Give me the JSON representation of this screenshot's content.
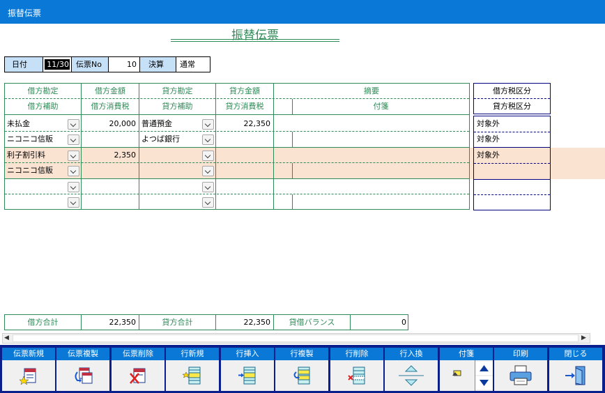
{
  "window": {
    "title": "振替伝票"
  },
  "doc_title": "振替伝票",
  "header": {
    "date_label": "日付",
    "date_value": "11/30",
    "voucher_no_label": "伝票No",
    "voucher_no_value": "10",
    "settlement_label": "決算",
    "settlement_value": "通常"
  },
  "columns": {
    "debit_account": "借方勘定",
    "debit_amount": "借方金額",
    "credit_account": "貸方勘定",
    "credit_amount": "貸方金額",
    "summary": "摘要",
    "debit_sub": "借方補助",
    "debit_tax": "借方消費税",
    "credit_sub": "貸方補助",
    "credit_tax": "貸方消費税",
    "note": "付箋",
    "debit_tax_class": "借方税区分",
    "credit_tax_class": "貸方税区分"
  },
  "rows": [
    {
      "debit_account": "未払金",
      "debit_amount": "20,000",
      "credit_account": "普通預金",
      "credit_amount": "22,350",
      "debit_sub": "ニコニコ信販",
      "credit_sub": "よつば銀行",
      "debit_tax_class": "対象外",
      "credit_tax_class": "対象外"
    },
    {
      "debit_account": "利子割引料",
      "debit_amount": "2,350",
      "credit_account": "",
      "credit_amount": "",
      "debit_sub": "ニコニコ信販",
      "credit_sub": "",
      "debit_tax_class": "対象外",
      "credit_tax_class": ""
    },
    {
      "debit_account": "",
      "debit_amount": "",
      "credit_account": "",
      "credit_amount": "",
      "debit_sub": "",
      "credit_sub": "",
      "debit_tax_class": "",
      "credit_tax_class": ""
    }
  ],
  "totals": {
    "debit_label": "借方合計",
    "debit_value": "22,350",
    "credit_label": "貸方合計",
    "credit_value": "22,350",
    "balance_label": "貸借バランス",
    "balance_value": "0"
  },
  "toolbar": [
    {
      "label": "伝票新規",
      "icon": "new-voucher-icon"
    },
    {
      "label": "伝票複製",
      "icon": "copy-voucher-icon"
    },
    {
      "label": "伝票削除",
      "icon": "delete-voucher-icon"
    },
    {
      "label": "行新規",
      "icon": "new-row-icon"
    },
    {
      "label": "行挿入",
      "icon": "insert-row-icon"
    },
    {
      "label": "行複製",
      "icon": "copy-row-icon"
    },
    {
      "label": "行削除",
      "icon": "delete-row-icon"
    },
    {
      "label": "行入換",
      "icon": "swap-rows-icon"
    },
    {
      "label": "付箋",
      "icon": "sticky-note-icon"
    },
    {
      "label": "印刷",
      "icon": "printer-icon"
    },
    {
      "label": "閉じる",
      "icon": "close-door-icon"
    }
  ],
  "colors": {
    "titlebar": "#0a78d7",
    "toolbar": "#0a1e8c",
    "header_label": "#c6e0f8",
    "grid_line": "#2e8b57",
    "highlight_row": "#fbe3d2"
  }
}
